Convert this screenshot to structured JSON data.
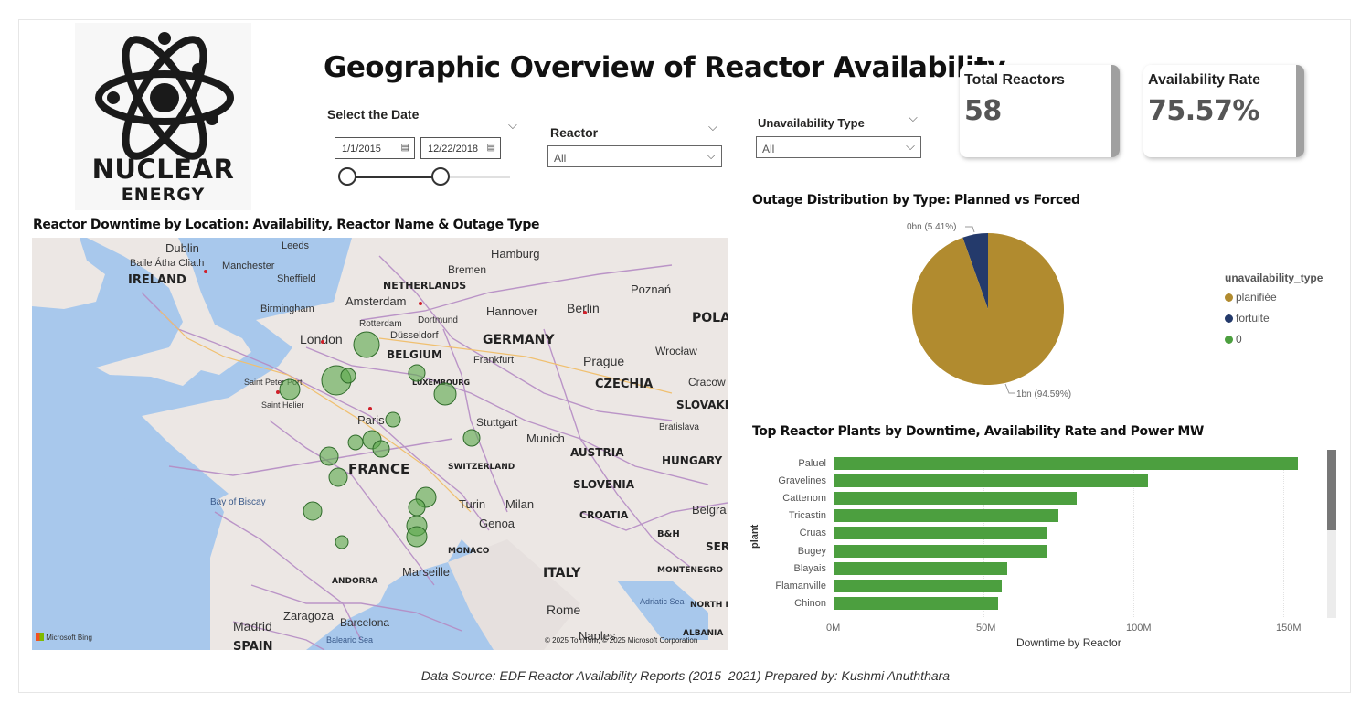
{
  "header": {
    "title": "Geographic Overview of Reactor Availability",
    "logo": {
      "line1": "NUCLEAR",
      "line2": "ENERGY",
      "icon": "atom-icon"
    }
  },
  "filters": {
    "date": {
      "label": "Select the Date",
      "start": "1/1/2015",
      "end": "12/22/2018",
      "icon": "calendar-icon"
    },
    "reactor": {
      "label": "Reactor",
      "value": "All"
    },
    "unavailability": {
      "label": "Unavailability Type",
      "value": "All"
    }
  },
  "kpis": {
    "total_reactors": {
      "label": "Total Reactors",
      "value": "58"
    },
    "availability_rate": {
      "label": "Availability Rate",
      "value": "75.57%"
    }
  },
  "map": {
    "title": "Reactor Downtime by Location: Availability, Reactor Name & Outage Type",
    "countries": [
      "IRELAND",
      "NETHERLANDS",
      "BELGIUM",
      "GERMANY",
      "POLAND",
      "CZECHIA",
      "SLOVAKIA",
      "FRANCE",
      "AUSTRIA",
      "HUNGARY",
      "SLOVENIA",
      "CROATIA",
      "ITALY",
      "SWITZERLAND",
      "LUXEMBOURG",
      "MONACO",
      "ANDORRA",
      "B&H",
      "MONTENEGRO",
      "ALBANIA",
      "SERB",
      "NORTH M",
      "SPAIN"
    ],
    "cities": [
      "Dublin",
      "Leeds",
      "Baile Átha Cliath",
      "Manchester",
      "Sheffield",
      "Birmingham",
      "London",
      "Amsterdam",
      "Rotterdam",
      "Dortmund",
      "Düsseldorf",
      "Hamburg",
      "Bremen",
      "Hannover",
      "Berlin",
      "Poznań",
      "Frankfurt",
      "Prague",
      "Wrocław",
      "Cracow",
      "Saint Peter Port",
      "Saint Helier",
      "Paris",
      "Stuttgart",
      "Munich",
      "Bratislava",
      "Bay of Biscay",
      "Turin",
      "Milan",
      "Genoa",
      "Marseille",
      "Zaragoza",
      "Barcelona",
      "Madrid",
      "Rome",
      "Naples",
      "Balearic Sea",
      "Adriatic Sea",
      "Belgra"
    ],
    "attribution_left": "Microsoft Bing",
    "attribution_right": "© 2025 TomTom, © 2025 Microsoft Corporation",
    "bubble_color": "#5aa84a"
  },
  "pie": {
    "title": "Outage Distribution by Type: Planned vs Forced",
    "legend_title": "unavailability_type",
    "legend": [
      {
        "name": "planifiée",
        "color": "#b18b2f"
      },
      {
        "name": "fortuite",
        "color": "#243a6b"
      },
      {
        "name": "0",
        "color": "#4c9f3f"
      }
    ],
    "labels": {
      "small": "0bn (5.41%)",
      "large": "1bn (94.59%)"
    }
  },
  "bar": {
    "title": "Top Reactor Plants by Downtime, Availability Rate and Power MW",
    "ylabel": "plant",
    "xlabel": "Downtime by Reactor",
    "ticks": [
      "0M",
      "50M",
      "100M",
      "150M"
    ]
  },
  "footer": "Data Source: EDF Reactor Availability Reports (2015–2021) Prepared by: Kushmi Anuththara",
  "chart_data": [
    {
      "type": "pie",
      "title": "Outage Distribution by Type: Planned vs Forced",
      "slices": [
        {
          "name": "planifiée",
          "value": 94.59,
          "color": "#b18b2f"
        },
        {
          "name": "fortuite",
          "value": 5.41,
          "color": "#243a6b"
        }
      ],
      "legend": "right"
    },
    {
      "type": "bar",
      "orientation": "horizontal",
      "title": "Top Reactor Plants by Downtime, Availability Rate and Power MW",
      "categories": [
        "Paluel",
        "Gravelines",
        "Cattenom",
        "Tricastin",
        "Cruas",
        "Bugey",
        "Blayais",
        "Flamanville",
        "Chinon"
      ],
      "values": [
        155,
        105,
        81,
        75,
        71,
        71,
        58,
        56,
        55
      ],
      "unit": "M",
      "xlim": [
        0,
        160
      ],
      "xlabel": "Downtime by Reactor",
      "ylabel": "plant",
      "color": "#4c9f3f"
    }
  ]
}
